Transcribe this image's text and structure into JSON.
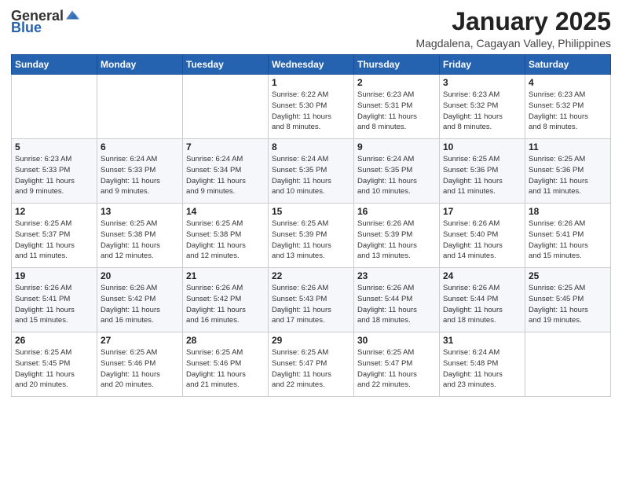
{
  "header": {
    "logo_general": "General",
    "logo_blue": "Blue",
    "title": "January 2025",
    "subtitle": "Magdalena, Cagayan Valley, Philippines"
  },
  "weekdays": [
    "Sunday",
    "Monday",
    "Tuesday",
    "Wednesday",
    "Thursday",
    "Friday",
    "Saturday"
  ],
  "weeks": [
    [
      {
        "day": "",
        "info": ""
      },
      {
        "day": "",
        "info": ""
      },
      {
        "day": "",
        "info": ""
      },
      {
        "day": "1",
        "info": "Sunrise: 6:22 AM\nSunset: 5:30 PM\nDaylight: 11 hours\nand 8 minutes."
      },
      {
        "day": "2",
        "info": "Sunrise: 6:23 AM\nSunset: 5:31 PM\nDaylight: 11 hours\nand 8 minutes."
      },
      {
        "day": "3",
        "info": "Sunrise: 6:23 AM\nSunset: 5:32 PM\nDaylight: 11 hours\nand 8 minutes."
      },
      {
        "day": "4",
        "info": "Sunrise: 6:23 AM\nSunset: 5:32 PM\nDaylight: 11 hours\nand 8 minutes."
      }
    ],
    [
      {
        "day": "5",
        "info": "Sunrise: 6:23 AM\nSunset: 5:33 PM\nDaylight: 11 hours\nand 9 minutes."
      },
      {
        "day": "6",
        "info": "Sunrise: 6:24 AM\nSunset: 5:33 PM\nDaylight: 11 hours\nand 9 minutes."
      },
      {
        "day": "7",
        "info": "Sunrise: 6:24 AM\nSunset: 5:34 PM\nDaylight: 11 hours\nand 9 minutes."
      },
      {
        "day": "8",
        "info": "Sunrise: 6:24 AM\nSunset: 5:35 PM\nDaylight: 11 hours\nand 10 minutes."
      },
      {
        "day": "9",
        "info": "Sunrise: 6:24 AM\nSunset: 5:35 PM\nDaylight: 11 hours\nand 10 minutes."
      },
      {
        "day": "10",
        "info": "Sunrise: 6:25 AM\nSunset: 5:36 PM\nDaylight: 11 hours\nand 11 minutes."
      },
      {
        "day": "11",
        "info": "Sunrise: 6:25 AM\nSunset: 5:36 PM\nDaylight: 11 hours\nand 11 minutes."
      }
    ],
    [
      {
        "day": "12",
        "info": "Sunrise: 6:25 AM\nSunset: 5:37 PM\nDaylight: 11 hours\nand 11 minutes."
      },
      {
        "day": "13",
        "info": "Sunrise: 6:25 AM\nSunset: 5:38 PM\nDaylight: 11 hours\nand 12 minutes."
      },
      {
        "day": "14",
        "info": "Sunrise: 6:25 AM\nSunset: 5:38 PM\nDaylight: 11 hours\nand 12 minutes."
      },
      {
        "day": "15",
        "info": "Sunrise: 6:25 AM\nSunset: 5:39 PM\nDaylight: 11 hours\nand 13 minutes."
      },
      {
        "day": "16",
        "info": "Sunrise: 6:26 AM\nSunset: 5:39 PM\nDaylight: 11 hours\nand 13 minutes."
      },
      {
        "day": "17",
        "info": "Sunrise: 6:26 AM\nSunset: 5:40 PM\nDaylight: 11 hours\nand 14 minutes."
      },
      {
        "day": "18",
        "info": "Sunrise: 6:26 AM\nSunset: 5:41 PM\nDaylight: 11 hours\nand 15 minutes."
      }
    ],
    [
      {
        "day": "19",
        "info": "Sunrise: 6:26 AM\nSunset: 5:41 PM\nDaylight: 11 hours\nand 15 minutes."
      },
      {
        "day": "20",
        "info": "Sunrise: 6:26 AM\nSunset: 5:42 PM\nDaylight: 11 hours\nand 16 minutes."
      },
      {
        "day": "21",
        "info": "Sunrise: 6:26 AM\nSunset: 5:42 PM\nDaylight: 11 hours\nand 16 minutes."
      },
      {
        "day": "22",
        "info": "Sunrise: 6:26 AM\nSunset: 5:43 PM\nDaylight: 11 hours\nand 17 minutes."
      },
      {
        "day": "23",
        "info": "Sunrise: 6:26 AM\nSunset: 5:44 PM\nDaylight: 11 hours\nand 18 minutes."
      },
      {
        "day": "24",
        "info": "Sunrise: 6:26 AM\nSunset: 5:44 PM\nDaylight: 11 hours\nand 18 minutes."
      },
      {
        "day": "25",
        "info": "Sunrise: 6:25 AM\nSunset: 5:45 PM\nDaylight: 11 hours\nand 19 minutes."
      }
    ],
    [
      {
        "day": "26",
        "info": "Sunrise: 6:25 AM\nSunset: 5:45 PM\nDaylight: 11 hours\nand 20 minutes."
      },
      {
        "day": "27",
        "info": "Sunrise: 6:25 AM\nSunset: 5:46 PM\nDaylight: 11 hours\nand 20 minutes."
      },
      {
        "day": "28",
        "info": "Sunrise: 6:25 AM\nSunset: 5:46 PM\nDaylight: 11 hours\nand 21 minutes."
      },
      {
        "day": "29",
        "info": "Sunrise: 6:25 AM\nSunset: 5:47 PM\nDaylight: 11 hours\nand 22 minutes."
      },
      {
        "day": "30",
        "info": "Sunrise: 6:25 AM\nSunset: 5:47 PM\nDaylight: 11 hours\nand 22 minutes."
      },
      {
        "day": "31",
        "info": "Sunrise: 6:24 AM\nSunset: 5:48 PM\nDaylight: 11 hours\nand 23 minutes."
      },
      {
        "day": "",
        "info": ""
      }
    ]
  ]
}
